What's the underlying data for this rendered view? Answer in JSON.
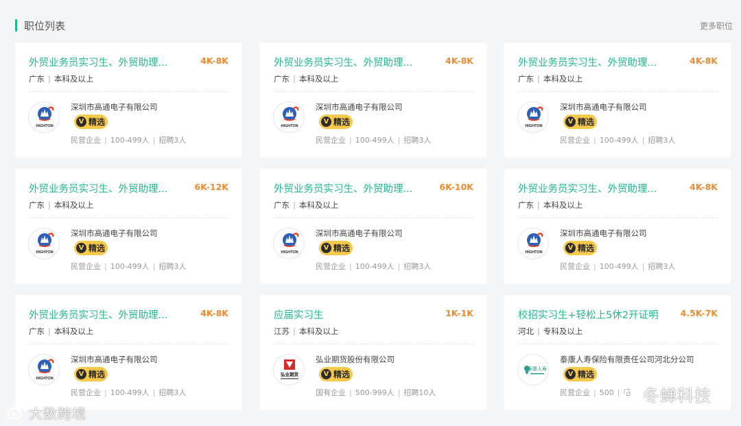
{
  "header": {
    "title": "职位列表",
    "more_label": "更多职位"
  },
  "badge_label": "精选",
  "badge_letter": "V",
  "jobs": [
    {
      "title": "外贸业务员实习生、外贸助理...",
      "salary": "4K-8K",
      "location": "广东",
      "education": "本科及以上",
      "company": "深圳市高通电子有限公司",
      "ownership": "民营企业",
      "size": "100-499人",
      "hiring": "招聘3人",
      "logo": "highton",
      "logo_text": "HIGHTON"
    },
    {
      "title": "外贸业务员实习生、外贸助理...",
      "salary": "4K-8K",
      "location": "广东",
      "education": "本科及以上",
      "company": "深圳市高通电子有限公司",
      "ownership": "民营企业",
      "size": "100-499人",
      "hiring": "招聘3人",
      "logo": "highton",
      "logo_text": "HIGHTON"
    },
    {
      "title": "外贸业务员实习生、外贸助理...",
      "salary": "4K-8K",
      "location": "广东",
      "education": "本科及以上",
      "company": "深圳市高通电子有限公司",
      "ownership": "民营企业",
      "size": "100-499人",
      "hiring": "招聘3人",
      "logo": "highton",
      "logo_text": "HIGHTON"
    },
    {
      "title": "外贸业务员实习生、外贸助理...",
      "salary": "6K-12K",
      "location": "广东",
      "education": "本科及以上",
      "company": "深圳市高通电子有限公司",
      "ownership": "民营企业",
      "size": "100-499人",
      "hiring": "招聘3人",
      "logo": "highton",
      "logo_text": "HIGHTON"
    },
    {
      "title": "外贸业务员实习生、外贸助理...",
      "salary": "6K-10K",
      "location": "广东",
      "education": "本科及以上",
      "company": "深圳市高通电子有限公司",
      "ownership": "民营企业",
      "size": "100-499人",
      "hiring": "招聘3人",
      "logo": "highton",
      "logo_text": "HIGHTON"
    },
    {
      "title": "外贸业务员实习生、外贸助理...",
      "salary": "4K-8K",
      "location": "广东",
      "education": "本科及以上",
      "company": "深圳市高通电子有限公司",
      "ownership": "民营企业",
      "size": "100-499人",
      "hiring": "招聘3人",
      "logo": "highton",
      "logo_text": "HIGHTON"
    },
    {
      "title": "外贸业务员实习生、外贸助理...",
      "salary": "4K-8K",
      "location": "广东",
      "education": "本科及以上",
      "company": "深圳市高通电子有限公司",
      "ownership": "民营企业",
      "size": "100-499人",
      "hiring": "招聘3人",
      "logo": "highton",
      "logo_text": "HIGHTON"
    },
    {
      "title": "应届实习生",
      "salary": "1K-1K",
      "location": "江苏",
      "education": "本科及以上",
      "company": "弘业期货股份有限公司",
      "ownership": "国有企业",
      "size": "500-999人",
      "hiring": "招聘10人",
      "logo": "hongye",
      "logo_text": "弘业期货"
    },
    {
      "title": "校招实习生+轻松上5休2开证明",
      "salary": "4.5K-7K",
      "location": "河北",
      "education": "专科及以上",
      "company": "泰康人寿保险有限责任公司河北分公司",
      "ownership": "民营企业",
      "size": "500",
      "hiring": "招",
      "logo": "taikang",
      "logo_text": "泰康人寿"
    }
  ],
  "watermarks": {
    "left": "大数跨境",
    "right": "冬蝉科技"
  },
  "colors": {
    "accent": "#1fb98f",
    "salary": "#f28a2e",
    "badge": "#f7c94a"
  }
}
